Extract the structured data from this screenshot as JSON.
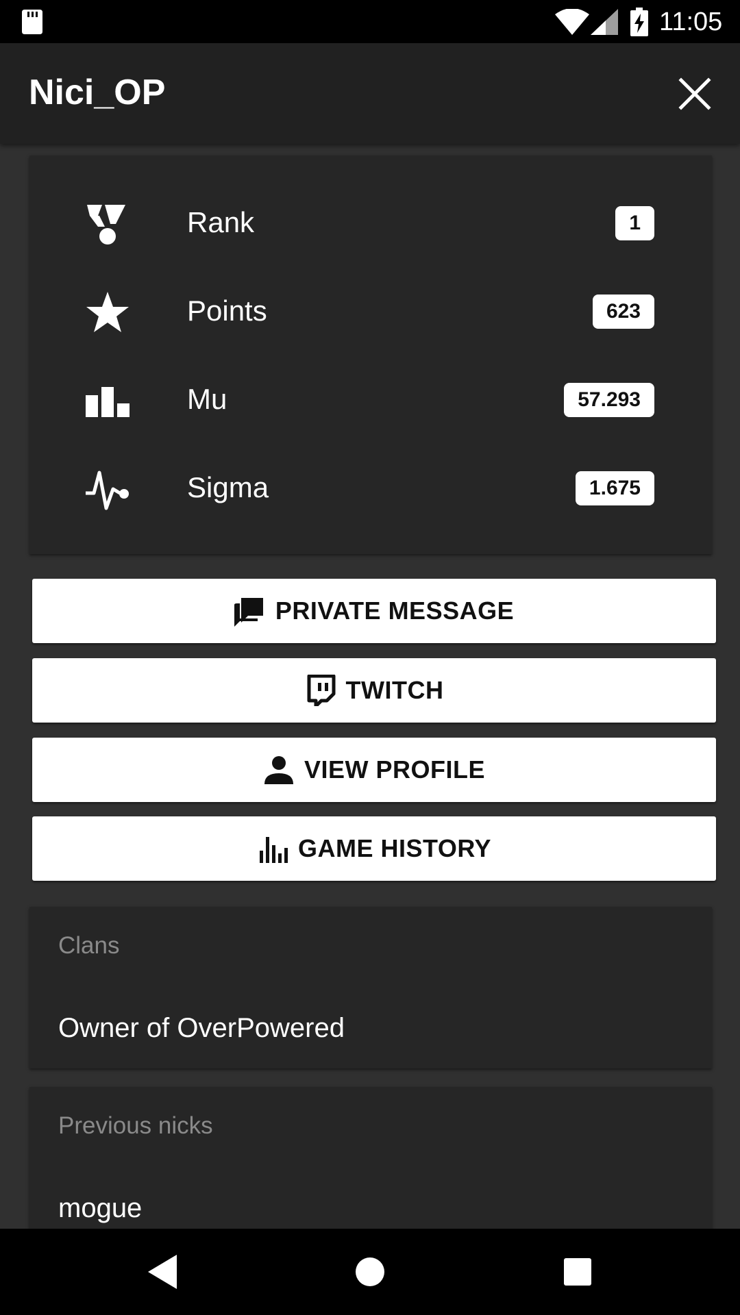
{
  "status_bar": {
    "time": "11:05"
  },
  "app_bar": {
    "title": "Nici_OP",
    "close_icon": "close-icon"
  },
  "stats": [
    {
      "label": "Rank",
      "value": "1",
      "icon": "medal-icon"
    },
    {
      "label": "Points",
      "value": "623",
      "icon": "star-icon"
    },
    {
      "label": "Mu",
      "value": "57.293",
      "icon": "bar-chart-icon"
    },
    {
      "label": "Sigma",
      "value": "1.675",
      "icon": "pulse-icon"
    }
  ],
  "actions": {
    "private_message": {
      "label": "PRIVATE MESSAGE",
      "icon": "forum-icon"
    },
    "twitch": {
      "label": "TWITCH",
      "icon": "twitch-icon"
    },
    "view_profile": {
      "label": "VIEW PROFILE",
      "icon": "person-icon"
    },
    "game_history": {
      "label": "GAME HISTORY",
      "icon": "equalizer-icon"
    }
  },
  "clans": {
    "heading": "Clans",
    "value": "Owner of OverPowered"
  },
  "previous_nicks": {
    "heading": "Previous nicks",
    "value": "mogue"
  },
  "colors": {
    "background": "#303030",
    "app_bar": "#212121",
    "card": "#262626",
    "button": "#ffffff",
    "heading_muted": "#8a8a8a"
  }
}
